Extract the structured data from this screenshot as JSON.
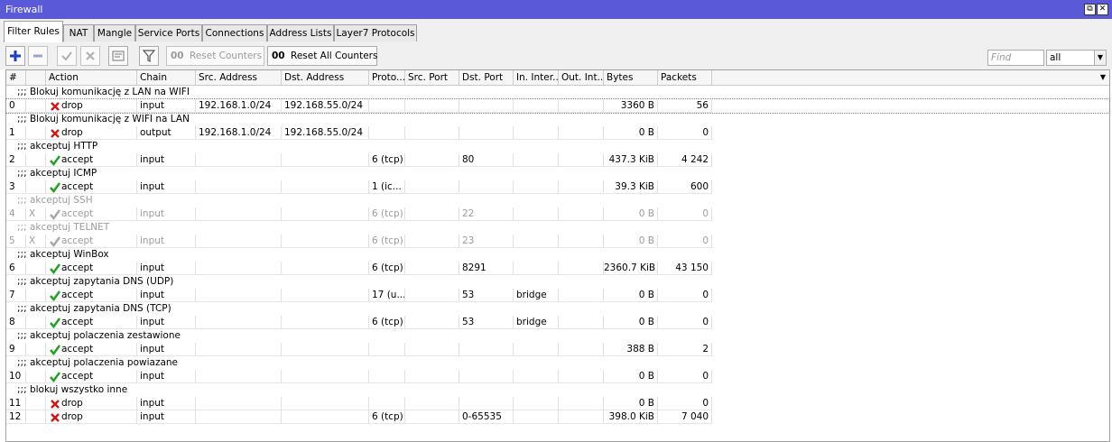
{
  "window": {
    "title": "Firewall",
    "restore_glyph": "⧉",
    "close_glyph": "✕"
  },
  "tabs": [
    {
      "label": "Filter Rules",
      "active": true
    },
    {
      "label": "NAT"
    },
    {
      "label": "Mangle"
    },
    {
      "label": "Service Ports"
    },
    {
      "label": "Connections"
    },
    {
      "label": "Address Lists"
    },
    {
      "label": "Layer7 Protocols"
    }
  ],
  "toolbar": {
    "add_icon": "plus-icon",
    "remove_icon": "minus-icon",
    "enable_icon": "check-icon",
    "disable_icon": "cross-icon",
    "comment_icon": "comment-icon",
    "filter_icon": "filter-icon",
    "reset_counters_prefix": "00",
    "reset_counters": "Reset Counters",
    "reset_all_counters_prefix": "00",
    "reset_all_counters": "Reset All Counters",
    "find_placeholder": "Find",
    "filter_value": "all"
  },
  "columns": [
    "#",
    "",
    "Action",
    "Chain",
    "Src. Address",
    "Dst. Address",
    "Proto...",
    "Src. Port",
    "Dst. Port",
    "In. Inter...",
    "Out. Int...",
    "Bytes",
    "Packets"
  ],
  "colors": {
    "accept": "#22a022",
    "drop": "#d01818",
    "title": "#5a5ad8"
  },
  "rows": [
    {
      "comment": ";;; Blokuj komunikację z LAN na WIFI",
      "num": "0",
      "flag": "",
      "action": "drop",
      "chain": "input",
      "src": "192.168.1.0/24",
      "dst": "192.168.55.0/24",
      "proto": "",
      "sport": "",
      "dport": "",
      "inif": "",
      "outif": "",
      "bytes": "3360 B",
      "packets": "56",
      "disabled": false
    },
    {
      "comment": ";;; Blokuj komunikację z WIFI na LAN",
      "num": "1",
      "flag": "",
      "action": "drop",
      "chain": "output",
      "src": "192.168.1.0/24",
      "dst": "192.168.55.0/24",
      "proto": "",
      "sport": "",
      "dport": "",
      "inif": "",
      "outif": "",
      "bytes": "0 B",
      "packets": "0",
      "disabled": false
    },
    {
      "comment": ";;; akceptuj HTTP",
      "num": "2",
      "flag": "",
      "action": "accept",
      "chain": "input",
      "src": "",
      "dst": "",
      "proto": "6 (tcp)",
      "sport": "",
      "dport": "80",
      "inif": "",
      "outif": "",
      "bytes": "437.3 KiB",
      "packets": "4 242",
      "disabled": false
    },
    {
      "comment": ";;; akceptuj ICMP",
      "num": "3",
      "flag": "",
      "action": "accept",
      "chain": "input",
      "src": "",
      "dst": "",
      "proto": "1 (ic...",
      "sport": "",
      "dport": "",
      "inif": "",
      "outif": "",
      "bytes": "39.3 KiB",
      "packets": "600",
      "disabled": false
    },
    {
      "comment": ";;; akceptuj SSH",
      "num": "4",
      "flag": "X",
      "action": "accept",
      "chain": "input",
      "src": "",
      "dst": "",
      "proto": "6 (tcp)",
      "sport": "",
      "dport": "22",
      "inif": "",
      "outif": "",
      "bytes": "0 B",
      "packets": "0",
      "disabled": true
    },
    {
      "comment": ";;; akceptuj TELNET",
      "num": "5",
      "flag": "X",
      "action": "accept",
      "chain": "input",
      "src": "",
      "dst": "",
      "proto": "6 (tcp)",
      "sport": "",
      "dport": "23",
      "inif": "",
      "outif": "",
      "bytes": "0 B",
      "packets": "0",
      "disabled": true
    },
    {
      "comment": ";;; akceptuj WinBox",
      "num": "6",
      "flag": "",
      "action": "accept",
      "chain": "input",
      "src": "",
      "dst": "",
      "proto": "6 (tcp)",
      "sport": "",
      "dport": "8291",
      "inif": "",
      "outif": "",
      "bytes": "2360.7 KiB",
      "packets": "43 150",
      "disabled": false
    },
    {
      "comment": ";;; akceptuj zapytania DNS (UDP)",
      "num": "7",
      "flag": "",
      "action": "accept",
      "chain": "input",
      "src": "",
      "dst": "",
      "proto": "17 (u...",
      "sport": "",
      "dport": "53",
      "inif": "bridge",
      "outif": "",
      "bytes": "0 B",
      "packets": "0",
      "disabled": false
    },
    {
      "comment": ";;; akceptuj zapytania DNS (TCP)",
      "num": "8",
      "flag": "",
      "action": "accept",
      "chain": "input",
      "src": "",
      "dst": "",
      "proto": "6 (tcp)",
      "sport": "",
      "dport": "53",
      "inif": "bridge",
      "outif": "",
      "bytes": "0 B",
      "packets": "0",
      "disabled": false
    },
    {
      "comment": ";;; akceptuj polaczenia zestawione",
      "num": "9",
      "flag": "",
      "action": "accept",
      "chain": "input",
      "src": "",
      "dst": "",
      "proto": "",
      "sport": "",
      "dport": "",
      "inif": "",
      "outif": "",
      "bytes": "388 B",
      "packets": "2",
      "disabled": false
    },
    {
      "comment": ";;; akceptuj polaczenia powiazane",
      "num": "10",
      "flag": "",
      "action": "accept",
      "chain": "input",
      "src": "",
      "dst": "",
      "proto": "",
      "sport": "",
      "dport": "",
      "inif": "",
      "outif": "",
      "bytes": "0 B",
      "packets": "0",
      "disabled": false
    },
    {
      "comment": ";;; blokuj wszystko inne",
      "num": "11",
      "flag": "",
      "action": "drop",
      "chain": "input",
      "src": "",
      "dst": "",
      "proto": "",
      "sport": "",
      "dport": "",
      "inif": "",
      "outif": "",
      "bytes": "0 B",
      "packets": "0",
      "disabled": false
    },
    {
      "comment": "",
      "num": "12",
      "flag": "",
      "action": "drop",
      "chain": "input",
      "src": "",
      "dst": "",
      "proto": "6 (tcp)",
      "sport": "",
      "dport": "0-65535",
      "inif": "",
      "outif": "",
      "bytes": "398.0 KiB",
      "packets": "7 040",
      "disabled": false
    }
  ]
}
